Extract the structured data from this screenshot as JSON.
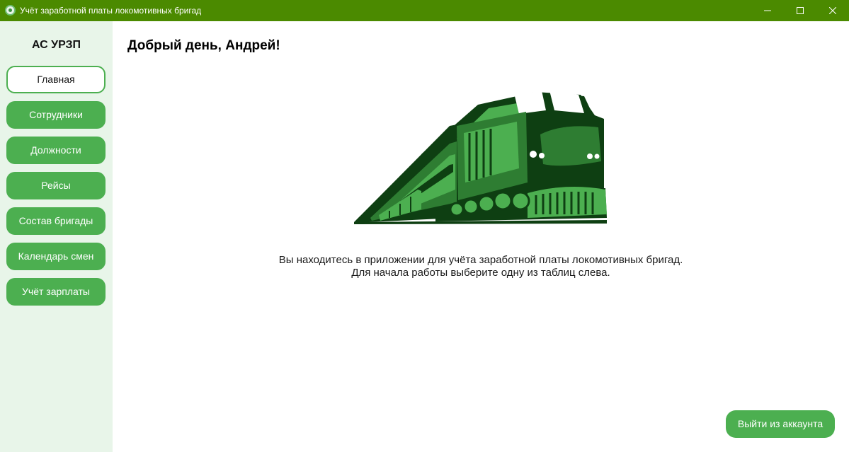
{
  "window": {
    "title": "Учёт заработной платы локомотивных бригад",
    "icon": "app-logo-icon",
    "controls": [
      "minimize-icon",
      "maximize-icon",
      "close-icon"
    ]
  },
  "sidebar": {
    "brand": "АС УРЗП",
    "items": [
      {
        "label": "Главная",
        "active": true
      },
      {
        "label": "Сотрудники",
        "active": false
      },
      {
        "label": "Должности",
        "active": false
      },
      {
        "label": "Рейсы",
        "active": false
      },
      {
        "label": "Состав бригады",
        "active": false
      },
      {
        "label": "Календарь смен",
        "active": false
      },
      {
        "label": "Учёт зарплаты",
        "active": false
      }
    ]
  },
  "main": {
    "greeting": "Добрый день, Андрей!",
    "illustration": "locomotive-illustration",
    "info_line1": "Вы находитесь в приложении для учёта заработной платы локомотивных бригад.",
    "info_line2": "Для начала работы выберите одну из таблиц слева.",
    "logout_label": "Выйти из аккаунта"
  },
  "colors": {
    "titlebar": "#4b8a00",
    "sidebar_bg": "#e8f5e9",
    "accent": "#4caf50",
    "train_dark": "#0e3f12",
    "train_mid": "#2e7d32",
    "train_light": "#4caf50"
  }
}
